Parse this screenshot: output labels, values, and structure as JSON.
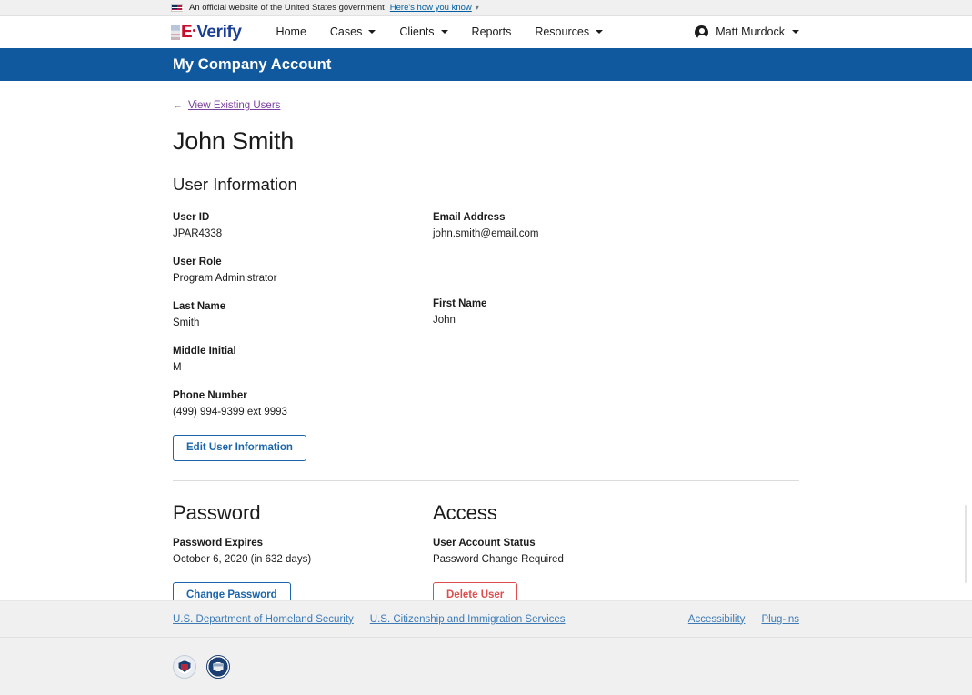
{
  "banner": {
    "text": "An official website of the United States government",
    "link": "Here's how you know",
    "flag_icon": "us-flag-icon",
    "caret_icon": "chevron-down-icon"
  },
  "topnav": {
    "logo": {
      "e": "E",
      "verify": "Verify",
      "alt": "E-Verify"
    },
    "items": [
      {
        "label": "Home",
        "has_menu": false
      },
      {
        "label": "Cases",
        "has_menu": true
      },
      {
        "label": "Clients",
        "has_menu": true
      },
      {
        "label": "Reports",
        "has_menu": false
      },
      {
        "label": "Resources",
        "has_menu": true
      }
    ],
    "user": {
      "name": "Matt Murdock",
      "avatar_icon": "account-circle-icon",
      "caret_icon": "chevron-down-icon"
    }
  },
  "page_banner": {
    "title": "My Company Account",
    "bg": "#11599e"
  },
  "back": {
    "arrow": "←",
    "label": "View Existing Users"
  },
  "person": {
    "name": "John Smith"
  },
  "user_information": {
    "heading": "User Information",
    "fields": {
      "user_id": {
        "label": "User ID",
        "value": "JPAR4338"
      },
      "email": {
        "label": "Email Address",
        "value": "john.smith@email.com"
      },
      "user_role": {
        "label": "User Role",
        "value": "Program Administrator"
      },
      "last_name": {
        "label": "Last Name",
        "value": "Smith"
      },
      "first_name": {
        "label": "First Name",
        "value": "John"
      },
      "middle_initial": {
        "label": "Middle Initial",
        "value": "M"
      },
      "phone": {
        "label": "Phone Number",
        "value": "(499) 994-9399 ext 9993"
      }
    },
    "edit_button": "Edit User Information"
  },
  "password": {
    "heading": "Password",
    "expires_label": "Password Expires",
    "expires_value": "October 6, 2020 (in 632 days)",
    "change_button": "Change Password"
  },
  "access": {
    "heading": "Access",
    "status_label": "User Account Status",
    "status_value": "Password Change Required",
    "delete_button": "Delete User"
  },
  "footer": {
    "left_links": [
      "U.S. Department of Homeland Security",
      "U.S. Citizenship and Immigration Services"
    ],
    "right_links": [
      "Accessibility",
      "Plug-ins"
    ],
    "seals": [
      "dhs-seal",
      "uscis-seal"
    ]
  },
  "colors": {
    "banner_blue": "#11599e",
    "link_blue": "#005ea2",
    "visited_purple": "#7b3f9d",
    "button_blue": "#1a65ab",
    "button_red": "#e04c4c",
    "logo_red": "#c8102e",
    "logo_navy": "#1b3f94",
    "footer_gray": "#f0f0f0"
  }
}
